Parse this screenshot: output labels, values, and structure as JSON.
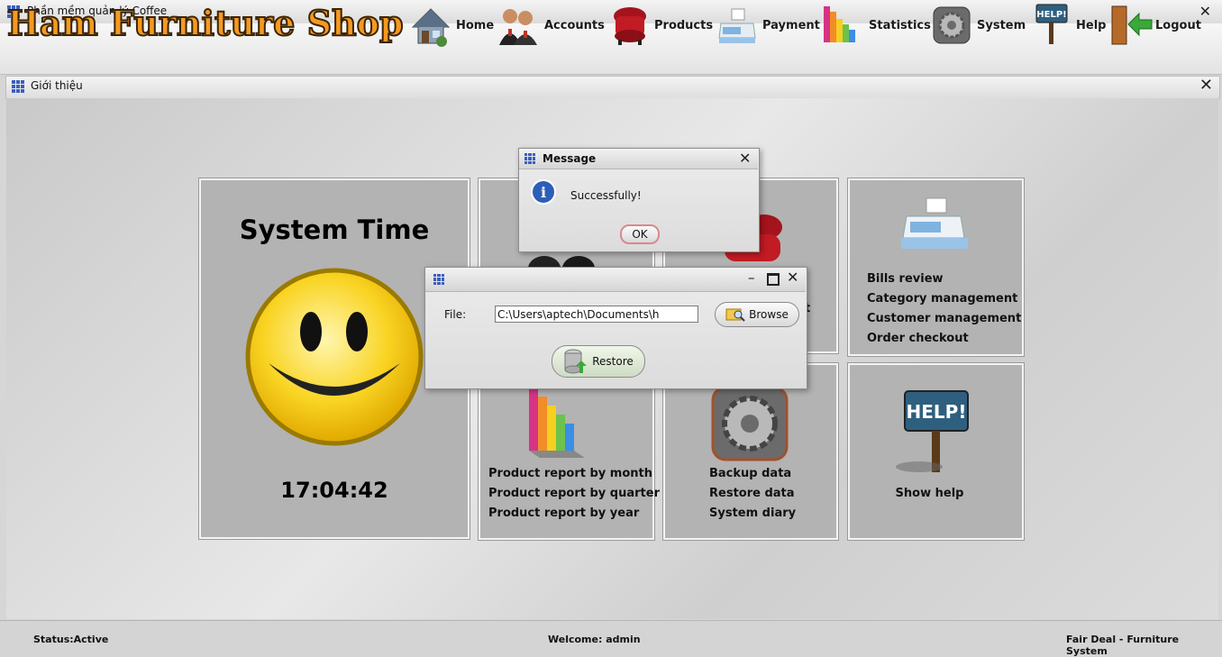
{
  "window": {
    "title": "Phần mềm quản lý Coffee"
  },
  "brand": {
    "text": "Ham Furniture Shop"
  },
  "toolbar": {
    "items": [
      {
        "label": "Home",
        "icon": "house-icon"
      },
      {
        "label": "Accounts",
        "icon": "people-icon"
      },
      {
        "label": "Products",
        "icon": "armchair-icon"
      },
      {
        "label": "Payment",
        "icon": "cash-register-icon"
      },
      {
        "label": "Statistics",
        "icon": "bar-chart-icon"
      },
      {
        "label": "System",
        "icon": "gears-icon"
      },
      {
        "label": "Help",
        "icon": "help-sign-icon"
      },
      {
        "label": "Logout",
        "icon": "door-exit-icon"
      }
    ]
  },
  "frame": {
    "title": "Giới thiệu"
  },
  "system_time": {
    "heading": "System Time",
    "time": "17:04:42"
  },
  "tiles": {
    "accounts_fragment": "",
    "products_fragment": "t",
    "payment": [
      "Bills review",
      "Category management",
      "Customer management",
      "Order checkout"
    ],
    "statistics": [
      "Product report by month",
      "Product report by quarter",
      "Product report by year"
    ],
    "system": [
      "Backup data",
      "Restore data",
      "System diary"
    ],
    "help": [
      "Show help"
    ]
  },
  "message_dialog": {
    "title": "Message",
    "text": "Successfully!",
    "ok_label": "OK"
  },
  "restore_dialog": {
    "file_label": "File:",
    "file_value": "C:\\Users\\aptech\\Documents\\h",
    "browse_label": "Browse",
    "restore_label": "Restore"
  },
  "status": {
    "left": "Status:Active",
    "center": "Welcome: admin",
    "right": "Fair Deal - Furniture System"
  },
  "colors": {
    "brand_orange": "#f59a1f",
    "tile_gray": "#b3b3b3",
    "smiley_yellow": "#f9d423"
  }
}
